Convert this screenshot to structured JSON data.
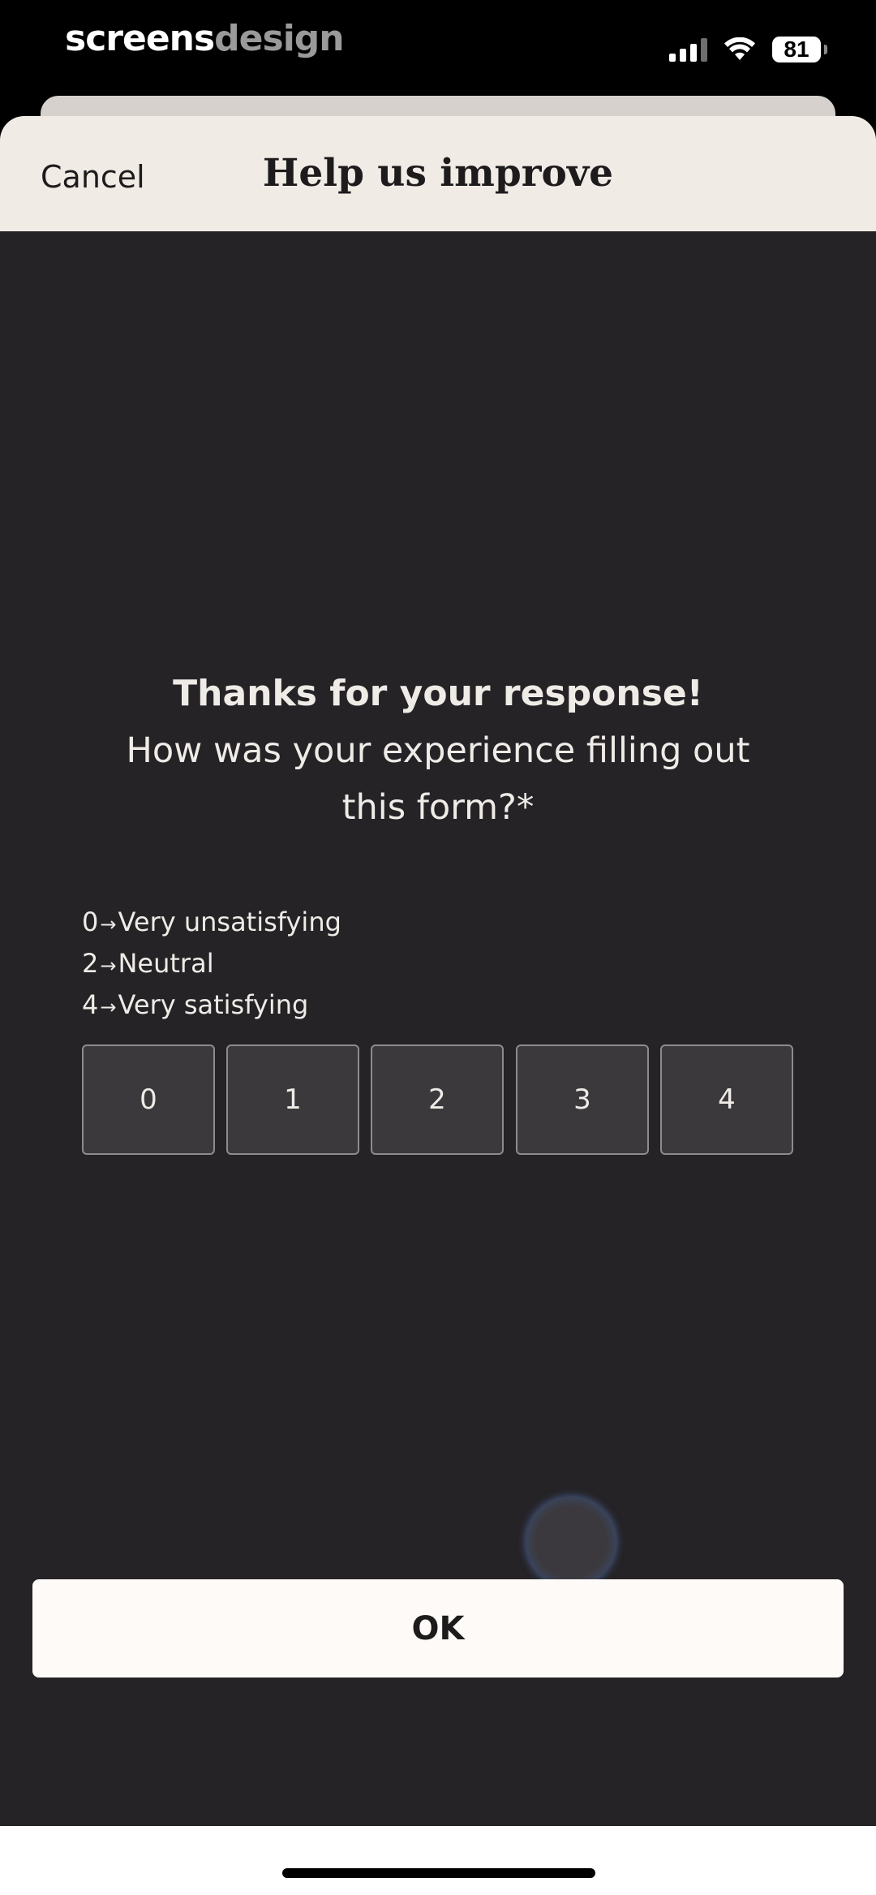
{
  "status_bar": {
    "brand_primary": "screens",
    "brand_secondary": "design",
    "battery_level": "81",
    "signal_bars_active": 3,
    "signal_bars_total": 4,
    "icons": [
      "cellular-signal-icon",
      "wifi-icon",
      "battery-icon"
    ]
  },
  "header": {
    "cancel_label": "Cancel",
    "title": "Help us improve"
  },
  "survey": {
    "thanks": "Thanks for your response!",
    "question": "How was your experience filling out this form?*",
    "legend": [
      {
        "value": "0",
        "arrow": "→",
        "label": "Very unsatisfying"
      },
      {
        "value": "2",
        "arrow": "→",
        "label": "Neutral"
      },
      {
        "value": "4",
        "arrow": "→",
        "label": "Very satisfying"
      }
    ],
    "options": [
      "0",
      "1",
      "2",
      "3",
      "4"
    ]
  },
  "footer": {
    "ok_label": "OK"
  },
  "colors": {
    "sheet_background": "#252326",
    "header_background": "#f1ebe6",
    "button_background": "#fdfaf7",
    "option_background": "#3b393b",
    "text_light": "#efebe7"
  }
}
